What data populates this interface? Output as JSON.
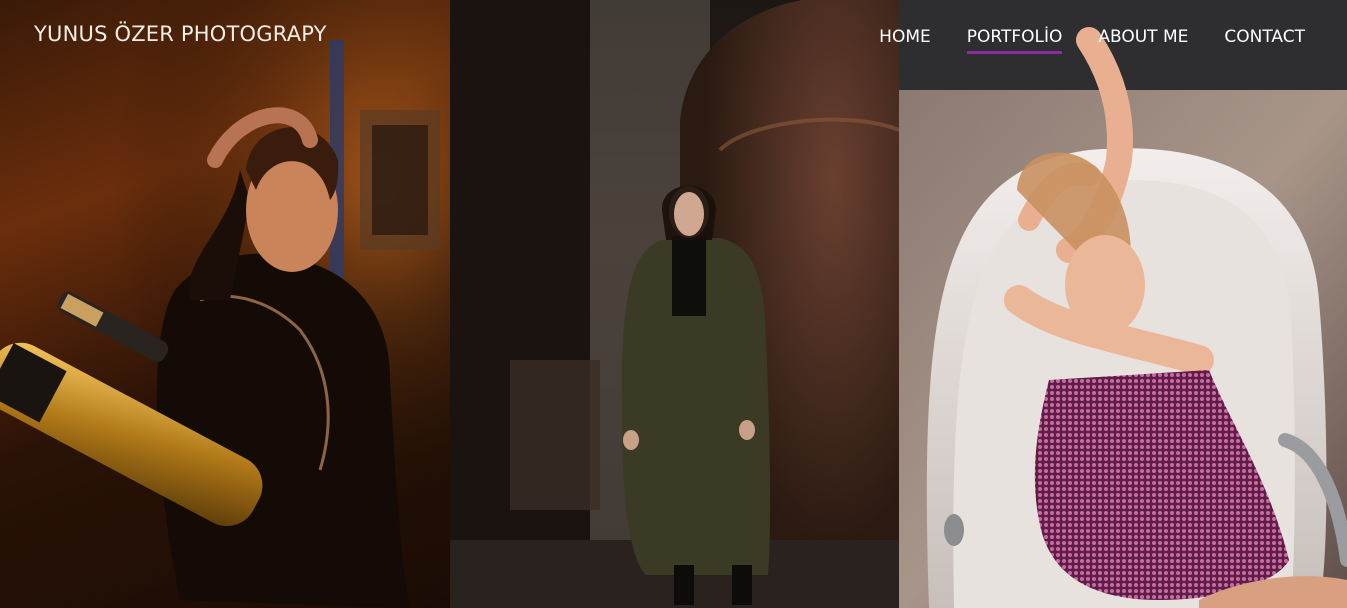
{
  "brand": {
    "title": "YUNUS ÖZER PHOTOGRAPY"
  },
  "nav": {
    "items": [
      {
        "label": "HOME",
        "active": false
      },
      {
        "label": "PORTFOLİO",
        "active": true
      },
      {
        "label": "ABOUT ME",
        "active": false
      },
      {
        "label": "CONTACT",
        "active": false
      }
    ],
    "accent_color": "#8a2b9e"
  },
  "gallery": {
    "photos": [
      {
        "subject": "woman in black latex with telescope"
      },
      {
        "subject": "woman in long olive coat"
      },
      {
        "subject": "woman in pink sequin dress in bathtub"
      }
    ]
  }
}
